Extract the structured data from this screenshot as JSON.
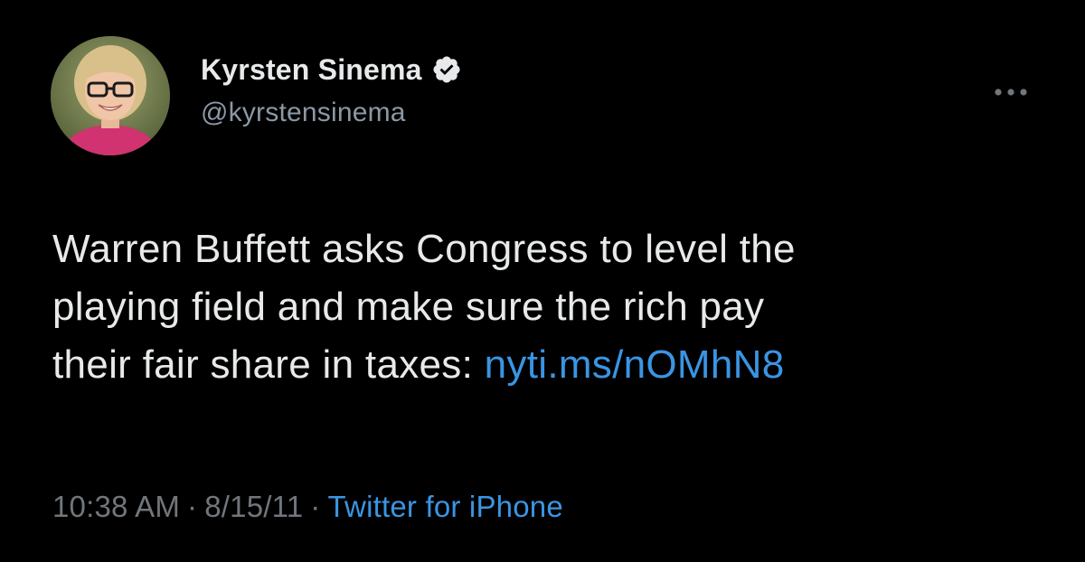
{
  "tweet": {
    "author": {
      "display_name": "Kyrsten Sinema",
      "handle": "@kyrstensinema",
      "verified": true,
      "avatar_icon": "profile-photo"
    },
    "more_icon": "more-horizontal-icon",
    "text_parts": [
      "Warren Buffett asks Congress to level the",
      "playing field and make sure the rich pay",
      "their fair share in taxes: "
    ],
    "link_text": "nyti.ms/nOMhN8",
    "time": "10:38 AM",
    "separator": "·",
    "date": "8/15/11",
    "source": "Twitter for iPhone"
  },
  "colors": {
    "background": "#000000",
    "text_primary": "#e7e9ea",
    "text_secondary": "#71767b",
    "link": "#3a95e3",
    "verified_fill": "#e7e9ea"
  }
}
